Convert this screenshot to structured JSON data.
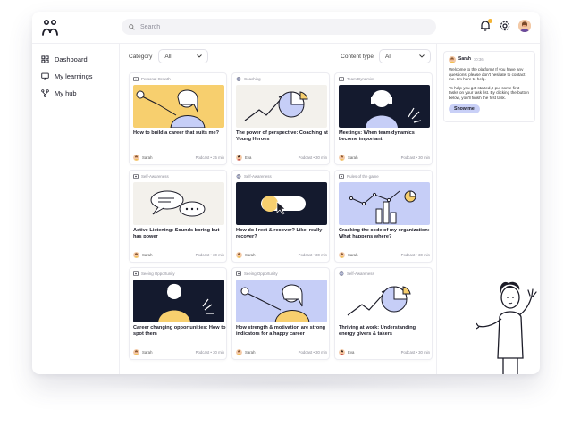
{
  "app": {
    "name": "Young Heroes"
  },
  "search": {
    "placeholder": "Search"
  },
  "nav": [
    {
      "label": "Dashboard",
      "icon": "grid-icon"
    },
    {
      "label": "My learnings",
      "icon": "monitor-icon"
    },
    {
      "label": "My hub",
      "icon": "hub-icon"
    }
  ],
  "filters": {
    "category_label": "Category",
    "category_value": "All",
    "content_label": "Content type",
    "content_value": "All"
  },
  "cards": [
    {
      "tag": "Personal Growth",
      "tag_icon": "podcast-icon",
      "title": "How to build a career that suits me?",
      "author": "Sarah",
      "type": "Podcast",
      "duration": "25 min",
      "thumb": "yellow-person-mic"
    },
    {
      "tag": "Coaching",
      "tag_icon": "article-icon",
      "title": "The power of perspective: Coaching at Young Heroes",
      "author": "Eva",
      "type": "Podcast",
      "duration": "30 min",
      "thumb": "light-chart"
    },
    {
      "tag": "Team Dynamics",
      "tag_icon": "podcast-icon",
      "title": "Meetings: When team dynamics become important",
      "author": "Sarah",
      "type": "Podcast",
      "duration": "30 min",
      "thumb": "dark-person-headphones"
    },
    {
      "tag": "Self-Awareness",
      "tag_icon": "podcast-icon",
      "title": "Active Listening: Sounds boring but has power",
      "author": "Sarah",
      "type": "Podcast",
      "duration": "30 min",
      "thumb": "light-speech-bubbles"
    },
    {
      "tag": "Self-Awareness",
      "tag_icon": "article-icon",
      "title": "How do I rest & recover? Like, really recover?",
      "author": "Sarah",
      "type": "Podcast",
      "duration": "30 min",
      "thumb": "dark-toggle"
    },
    {
      "tag": "Rules of the game",
      "tag_icon": "podcast-icon",
      "title": "Cracking the code of my organization: What happens where?",
      "author": "Sarah",
      "type": "Podcast",
      "duration": "30 min",
      "thumb": "blue-bars"
    },
    {
      "tag": "Seeing Opportunity",
      "tag_icon": "podcast-icon",
      "title": "Career changing opportunities: How to spot them",
      "author": "Sarah",
      "type": "Podcast",
      "duration": "30 min",
      "thumb": "dark-person-yellow"
    },
    {
      "tag": "Seeing Opportunity",
      "tag_icon": "podcast-icon",
      "title": "How strength & motivation are strong indicators for a happy career",
      "author": "Sarah",
      "type": "Podcast",
      "duration": "30 min",
      "thumb": "blue-person-mic"
    },
    {
      "tag": "Self-Awareness",
      "tag_icon": "article-icon",
      "title": "Thriving at work: Understanding energy givers & takers",
      "author": "Eva",
      "type": "Podcast",
      "duration": "30 min",
      "thumb": "white-chart"
    }
  ],
  "chat": {
    "name": "Sarah",
    "time": "10:36",
    "message1": "Welcome to the platform! If you have any questions, please don't hesitate to contact me. I'm here to help.",
    "message2": "To help you get started, I put some first tasks on your task list. By clicking the button below, you'll finish the first task.",
    "button": "Show me"
  },
  "colors": {
    "accent_yellow": "#f7cf6e",
    "accent_blue": "#c6cef7",
    "dark": "#141a2e",
    "chip": "#c9d0f7"
  }
}
